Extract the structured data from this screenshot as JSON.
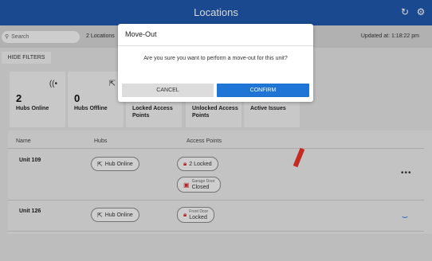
{
  "header": {
    "title": "Locations",
    "refresh_icon": "↻",
    "settings_icon": "⚙"
  },
  "toolbar": {
    "search_placeholder": "Search",
    "search_icon": "⚲",
    "location_count": "2 Locations",
    "updated": "Updated at: 1:18:22 pm",
    "hide_filters": "HIDE FILTERS"
  },
  "cards": [
    {
      "number": "2",
      "label": "Hubs Online",
      "icon": "wifi-icon"
    },
    {
      "number": "0",
      "label": "Hubs Offline",
      "icon": "hub-offline-icon"
    },
    {
      "number": "",
      "label": "Locked Access Points",
      "icon": ""
    },
    {
      "number": "",
      "label": "Unlocked Access Points",
      "icon": ""
    },
    {
      "number": "",
      "label": "Active Issues",
      "icon": ""
    }
  ],
  "list": {
    "headers": {
      "name": "Name",
      "hubs": "Hubs",
      "access_points": "Access Points"
    },
    "rows": [
      {
        "unit": "Unit 109",
        "hub": "Hub Online",
        "access": [
          {
            "small": "",
            "big": "2 Locked",
            "icon": "lock-icon"
          },
          {
            "small": "Garage Door",
            "big": "Closed",
            "icon": "garage-icon"
          }
        ],
        "action": "more"
      },
      {
        "unit": "Unit 126",
        "hub": "Hub Online",
        "access": [
          {
            "small": "Front Door",
            "big": "Locked",
            "icon": "lock-icon"
          }
        ],
        "action": "loading"
      }
    ]
  },
  "dialog": {
    "title": "Move-Out",
    "message": "Are you sure you want to perform a move-out for this unit?",
    "cancel": "CANCEL",
    "confirm": "CONFIRM"
  },
  "colors": {
    "header_bg": "#1f56a8",
    "confirm_bg": "#1f75d6",
    "annotation_mark": "#e8312a"
  }
}
